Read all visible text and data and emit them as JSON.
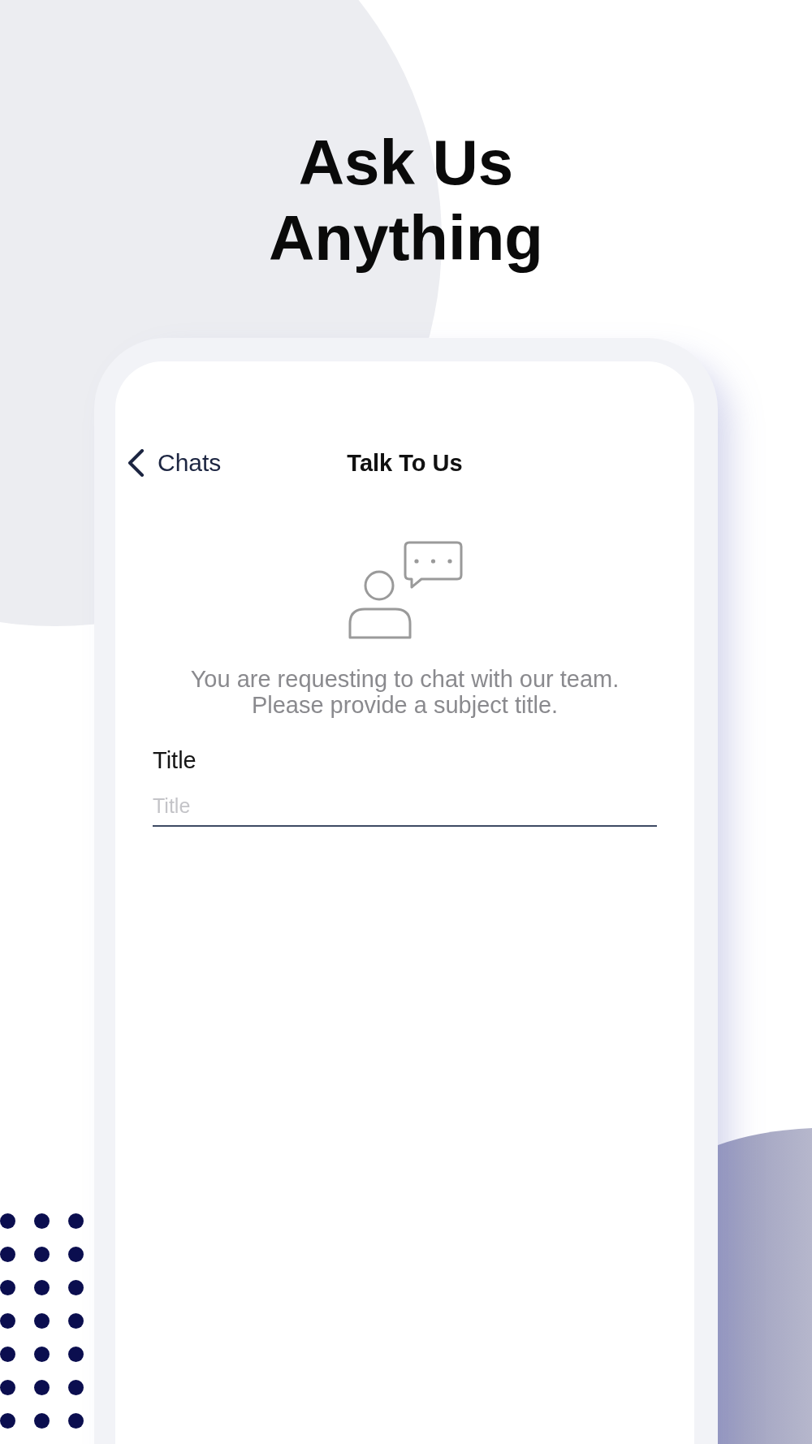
{
  "headline": "Ask Us Anything",
  "screen": {
    "nav_bar": {
      "back_label": "Chats",
      "title": "Talk To Us"
    },
    "intro_text": "You are requesting to chat with our team. Please provide a subject title.",
    "form": {
      "field_label": "Title",
      "field": {
        "placeholder": "Title"
      }
    }
  }
}
